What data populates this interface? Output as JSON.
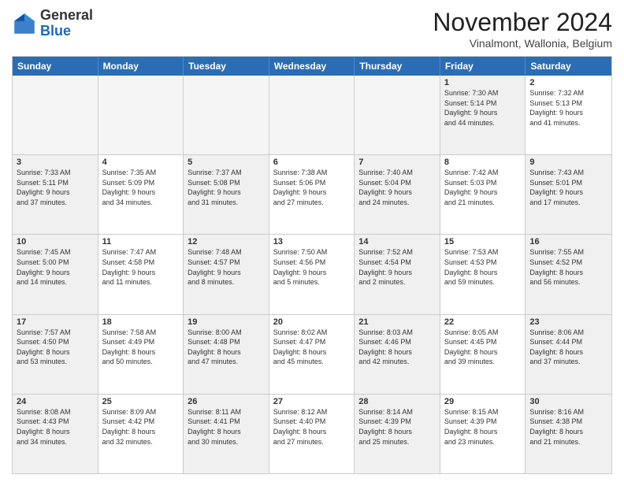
{
  "logo": {
    "general": "General",
    "blue": "Blue"
  },
  "header": {
    "title": "November 2024",
    "subtitle": "Vinalmont, Wallonia, Belgium"
  },
  "weekdays": [
    "Sunday",
    "Monday",
    "Tuesday",
    "Wednesday",
    "Thursday",
    "Friday",
    "Saturday"
  ],
  "rows": [
    [
      {
        "day": "",
        "info": "",
        "empty": true
      },
      {
        "day": "",
        "info": "",
        "empty": true
      },
      {
        "day": "",
        "info": "",
        "empty": true
      },
      {
        "day": "",
        "info": "",
        "empty": true
      },
      {
        "day": "",
        "info": "",
        "empty": true
      },
      {
        "day": "1",
        "info": "Sunrise: 7:30 AM\nSunset: 5:14 PM\nDaylight: 9 hours\nand 44 minutes.",
        "shaded": true
      },
      {
        "day": "2",
        "info": "Sunrise: 7:32 AM\nSunset: 5:13 PM\nDaylight: 9 hours\nand 41 minutes.",
        "shaded": false
      }
    ],
    [
      {
        "day": "3",
        "info": "Sunrise: 7:33 AM\nSunset: 5:11 PM\nDaylight: 9 hours\nand 37 minutes.",
        "shaded": true
      },
      {
        "day": "4",
        "info": "Sunrise: 7:35 AM\nSunset: 5:09 PM\nDaylight: 9 hours\nand 34 minutes.",
        "shaded": false
      },
      {
        "day": "5",
        "info": "Sunrise: 7:37 AM\nSunset: 5:08 PM\nDaylight: 9 hours\nand 31 minutes.",
        "shaded": true
      },
      {
        "day": "6",
        "info": "Sunrise: 7:38 AM\nSunset: 5:06 PM\nDaylight: 9 hours\nand 27 minutes.",
        "shaded": false
      },
      {
        "day": "7",
        "info": "Sunrise: 7:40 AM\nSunset: 5:04 PM\nDaylight: 9 hours\nand 24 minutes.",
        "shaded": true
      },
      {
        "day": "8",
        "info": "Sunrise: 7:42 AM\nSunset: 5:03 PM\nDaylight: 9 hours\nand 21 minutes.",
        "shaded": false
      },
      {
        "day": "9",
        "info": "Sunrise: 7:43 AM\nSunset: 5:01 PM\nDaylight: 9 hours\nand 17 minutes.",
        "shaded": true
      }
    ],
    [
      {
        "day": "10",
        "info": "Sunrise: 7:45 AM\nSunset: 5:00 PM\nDaylight: 9 hours\nand 14 minutes.",
        "shaded": true
      },
      {
        "day": "11",
        "info": "Sunrise: 7:47 AM\nSunset: 4:58 PM\nDaylight: 9 hours\nand 11 minutes.",
        "shaded": false
      },
      {
        "day": "12",
        "info": "Sunrise: 7:48 AM\nSunset: 4:57 PM\nDaylight: 9 hours\nand 8 minutes.",
        "shaded": true
      },
      {
        "day": "13",
        "info": "Sunrise: 7:50 AM\nSunset: 4:56 PM\nDaylight: 9 hours\nand 5 minutes.",
        "shaded": false
      },
      {
        "day": "14",
        "info": "Sunrise: 7:52 AM\nSunset: 4:54 PM\nDaylight: 9 hours\nand 2 minutes.",
        "shaded": true
      },
      {
        "day": "15",
        "info": "Sunrise: 7:53 AM\nSunset: 4:53 PM\nDaylight: 8 hours\nand 59 minutes.",
        "shaded": false
      },
      {
        "day": "16",
        "info": "Sunrise: 7:55 AM\nSunset: 4:52 PM\nDaylight: 8 hours\nand 56 minutes.",
        "shaded": true
      }
    ],
    [
      {
        "day": "17",
        "info": "Sunrise: 7:57 AM\nSunset: 4:50 PM\nDaylight: 8 hours\nand 53 minutes.",
        "shaded": true
      },
      {
        "day": "18",
        "info": "Sunrise: 7:58 AM\nSunset: 4:49 PM\nDaylight: 8 hours\nand 50 minutes.",
        "shaded": false
      },
      {
        "day": "19",
        "info": "Sunrise: 8:00 AM\nSunset: 4:48 PM\nDaylight: 8 hours\nand 47 minutes.",
        "shaded": true
      },
      {
        "day": "20",
        "info": "Sunrise: 8:02 AM\nSunset: 4:47 PM\nDaylight: 8 hours\nand 45 minutes.",
        "shaded": false
      },
      {
        "day": "21",
        "info": "Sunrise: 8:03 AM\nSunset: 4:46 PM\nDaylight: 8 hours\nand 42 minutes.",
        "shaded": true
      },
      {
        "day": "22",
        "info": "Sunrise: 8:05 AM\nSunset: 4:45 PM\nDaylight: 8 hours\nand 39 minutes.",
        "shaded": false
      },
      {
        "day": "23",
        "info": "Sunrise: 8:06 AM\nSunset: 4:44 PM\nDaylight: 8 hours\nand 37 minutes.",
        "shaded": true
      }
    ],
    [
      {
        "day": "24",
        "info": "Sunrise: 8:08 AM\nSunset: 4:43 PM\nDaylight: 8 hours\nand 34 minutes.",
        "shaded": true
      },
      {
        "day": "25",
        "info": "Sunrise: 8:09 AM\nSunset: 4:42 PM\nDaylight: 8 hours\nand 32 minutes.",
        "shaded": false
      },
      {
        "day": "26",
        "info": "Sunrise: 8:11 AM\nSunset: 4:41 PM\nDaylight: 8 hours\nand 30 minutes.",
        "shaded": true
      },
      {
        "day": "27",
        "info": "Sunrise: 8:12 AM\nSunset: 4:40 PM\nDaylight: 8 hours\nand 27 minutes.",
        "shaded": false
      },
      {
        "day": "28",
        "info": "Sunrise: 8:14 AM\nSunset: 4:39 PM\nDaylight: 8 hours\nand 25 minutes.",
        "shaded": true
      },
      {
        "day": "29",
        "info": "Sunrise: 8:15 AM\nSunset: 4:39 PM\nDaylight: 8 hours\nand 23 minutes.",
        "shaded": false
      },
      {
        "day": "30",
        "info": "Sunrise: 8:16 AM\nSunset: 4:38 PM\nDaylight: 8 hours\nand 21 minutes.",
        "shaded": true
      }
    ]
  ]
}
